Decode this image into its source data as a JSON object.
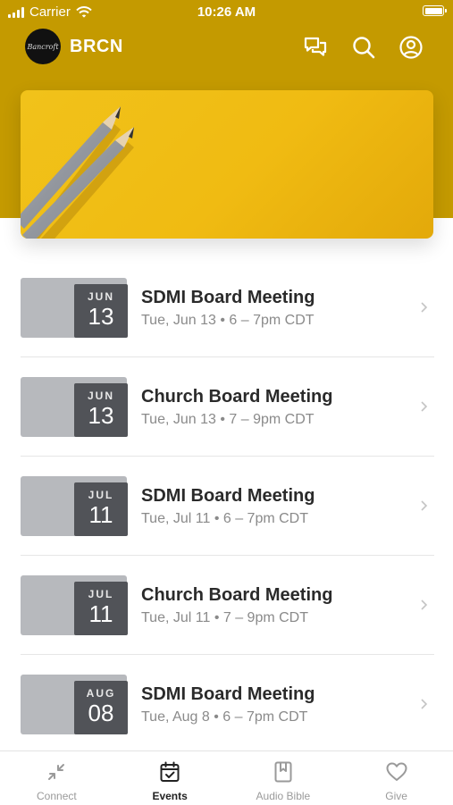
{
  "status_bar": {
    "carrier": "Carrier",
    "time": "10:26 AM"
  },
  "header": {
    "logo_text": "Bancroft",
    "title": "BRCN"
  },
  "icons": {
    "messages": "chat-bubbles-icon",
    "search": "search-icon",
    "account": "account-icon"
  },
  "events": [
    {
      "month": "JUN",
      "day": "13",
      "title": "SDMI Board Meeting",
      "subtitle": "Tue, Jun 13 • 6 – 7pm CDT"
    },
    {
      "month": "JUN",
      "day": "13",
      "title": "Church Board Meeting",
      "subtitle": "Tue, Jun 13 • 7 – 9pm CDT"
    },
    {
      "month": "JUL",
      "day": "11",
      "title": "SDMI Board Meeting",
      "subtitle": "Tue, Jul 11 • 6 – 7pm CDT"
    },
    {
      "month": "JUL",
      "day": "11",
      "title": "Church Board Meeting",
      "subtitle": "Tue, Jul 11 • 7 – 9pm CDT"
    },
    {
      "month": "AUG",
      "day": "08",
      "title": "SDMI Board Meeting",
      "subtitle": "Tue, Aug 8 • 6 – 7pm CDT"
    }
  ],
  "tabs": [
    {
      "label": "Connect",
      "icon": "arrows-collapse-icon",
      "active": false
    },
    {
      "label": "Events",
      "icon": "calendar-check-icon",
      "active": true
    },
    {
      "label": "Audio Bible",
      "icon": "bookmark-book-icon",
      "active": false
    },
    {
      "label": "Give",
      "icon": "heart-icon",
      "active": false
    }
  ],
  "colors": {
    "accent": "#c49a00",
    "hero": "#f1c21a",
    "badge": "#515358"
  }
}
